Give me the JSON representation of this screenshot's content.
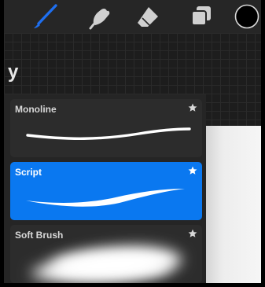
{
  "toolbar": {
    "tools": [
      {
        "icon": "paintbrush-icon",
        "active": true
      },
      {
        "icon": "smudge-icon",
        "active": false
      },
      {
        "icon": "eraser-icon",
        "active": false
      },
      {
        "icon": "layers-icon",
        "active": false
      },
      {
        "icon": "color-picker-icon",
        "active": false
      }
    ],
    "active_color": "#1e6ff0",
    "current_color": "#000000"
  },
  "panel": {
    "title": "y"
  },
  "brushes": [
    {
      "name": "Monoline",
      "selected": false,
      "stroke_icon": "monoline-stroke-preview"
    },
    {
      "name": "Script",
      "selected": true,
      "stroke_icon": "script-stroke-preview"
    },
    {
      "name": "Soft Brush",
      "selected": false,
      "stroke_icon": "soft-brush-stroke-preview"
    }
  ],
  "colors": {
    "selection": "#0a78f0",
    "panel_bg": "#252525"
  }
}
